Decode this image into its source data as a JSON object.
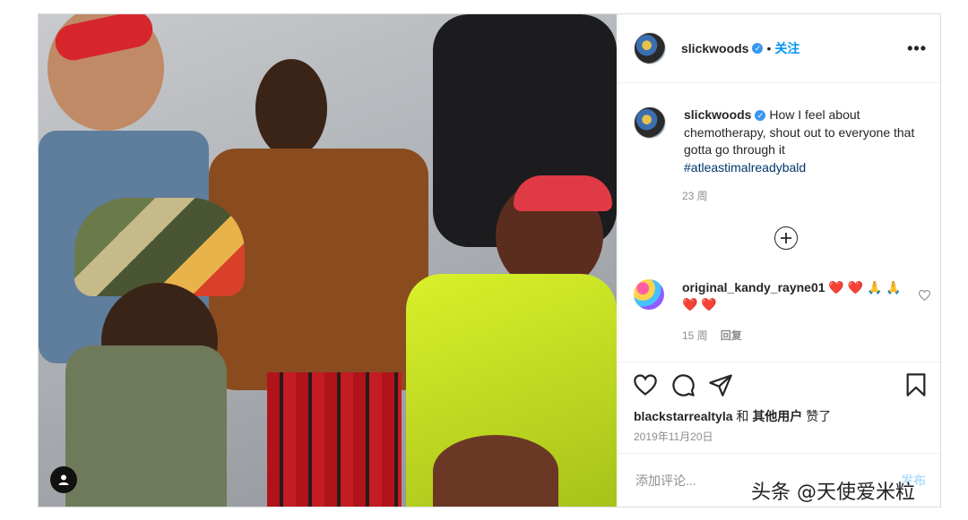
{
  "header": {
    "username": "slickwoods",
    "separator": "•",
    "follow_label": "关注",
    "more_icon": "more-horizontal-icon"
  },
  "caption": {
    "username": "slickwoods",
    "text": "How I feel about chemotherapy, shout out to everyone that gotta go through it",
    "hashtag": "#atleastimalreadybald",
    "time": "23 周"
  },
  "comment": {
    "username": "original_kandy_rayne01",
    "emojis": "❤️ ❤️ 🙏 🙏 ❤️ ❤️",
    "time": "15 周",
    "reply_label": "回复"
  },
  "likes": {
    "user": "blackstarrealtyla",
    "joiner": "和",
    "others": "其他用户",
    "suffix": "赞了"
  },
  "date": "2019年11月20日",
  "comment_box": {
    "placeholder": "添加评论...",
    "post_label": "发布"
  },
  "watermark": "头条 @天使爱米粒",
  "colors": {
    "link_blue": "#0095f6",
    "hashtag": "#00376b",
    "verified": "#3897f0",
    "heart_red": "#ed4956",
    "muted": "#8e8e8e"
  }
}
